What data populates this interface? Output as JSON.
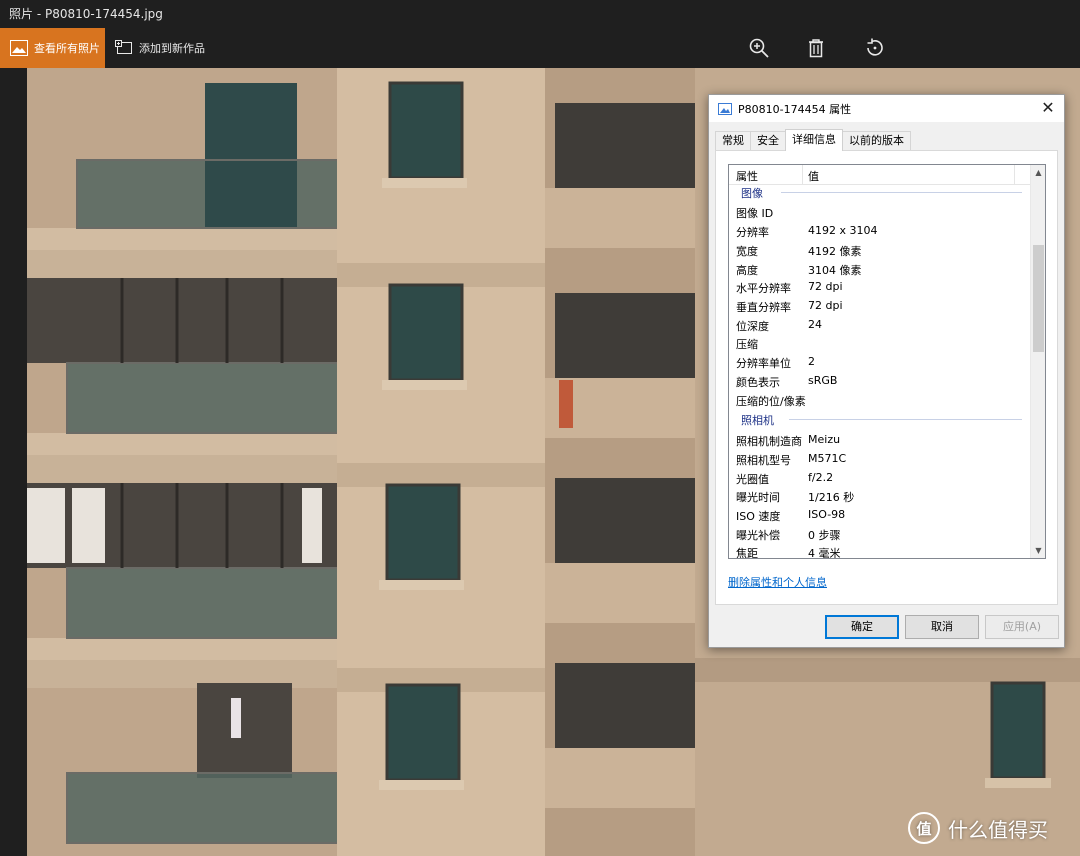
{
  "window": {
    "title": "照片 - P80810-174454.jpg"
  },
  "toolbar": {
    "see_all_label": "查看所有照片",
    "add_to_creation_label": "添加到新作品",
    "icons": [
      "zoom-in-icon",
      "delete-icon",
      "rotate-icon"
    ]
  },
  "dialog": {
    "title": "P80810-174454 属性",
    "tabs": [
      "常规",
      "安全",
      "详细信息",
      "以前的版本"
    ],
    "active_tab": "详细信息",
    "columns": {
      "property": "属性",
      "value": "值"
    },
    "groups": {
      "image": "图像",
      "camera": "照相机"
    },
    "image_rows": [
      {
        "k": "图像 ID",
        "v": ""
      },
      {
        "k": "分辨率",
        "v": "4192 x 3104"
      },
      {
        "k": "宽度",
        "v": "4192 像素"
      },
      {
        "k": "高度",
        "v": "3104 像素"
      },
      {
        "k": "水平分辨率",
        "v": "72 dpi"
      },
      {
        "k": "垂直分辨率",
        "v": "72 dpi"
      },
      {
        "k": "位深度",
        "v": "24"
      },
      {
        "k": "压缩",
        "v": ""
      },
      {
        "k": "分辨率单位",
        "v": "2"
      },
      {
        "k": "颜色表示",
        "v": "sRGB"
      },
      {
        "k": "压缩的位/像素",
        "v": ""
      }
    ],
    "camera_rows": [
      {
        "k": "照相机制造商",
        "v": "Meizu"
      },
      {
        "k": "照相机型号",
        "v": "M571C"
      },
      {
        "k": "光圈值",
        "v": "f/2.2"
      },
      {
        "k": "曝光时间",
        "v": "1/216 秒"
      },
      {
        "k": "ISO 速度",
        "v": "ISO-98"
      },
      {
        "k": "曝光补偿",
        "v": "0 步骤"
      },
      {
        "k": "焦距",
        "v": "4 毫米"
      }
    ],
    "remove_link": "删除属性和个人信息",
    "ok": "确定",
    "cancel": "取消",
    "apply": "应用(A)"
  },
  "watermark": {
    "logo_text": "值",
    "text": "什么值得买"
  },
  "colors": {
    "accent": "#d8741f",
    "link": "#0066cc",
    "group": "#1e3287"
  }
}
